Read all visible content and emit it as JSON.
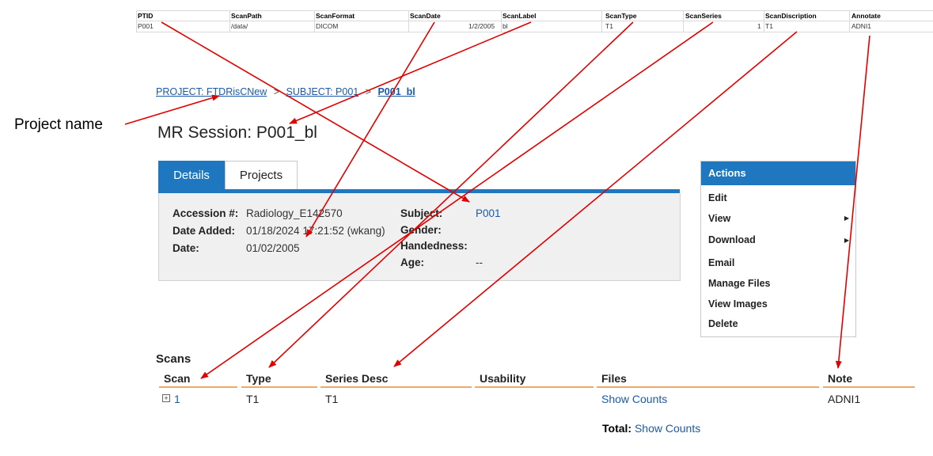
{
  "sheet": {
    "headers": [
      "PTID",
      "ScanPath",
      "ScanFormat",
      "ScanDate",
      "ScanLabel",
      "ScanType",
      "ScanSeries",
      "ScanDiscription",
      "Annotate"
    ],
    "values": [
      "P001",
      "/data/",
      "DICOM",
      "1/2/2005",
      "bl",
      "T1",
      "1",
      "T1",
      "ADNI1"
    ]
  },
  "annotation": {
    "project_name": "Project name"
  },
  "breadcrumb": {
    "project": "PROJECT: FTDRisCNew",
    "sep1": ">",
    "subject": "SUBJECT: P001",
    "sep2": ">",
    "session": "P001_bl"
  },
  "title": "MR Session: P001_bl",
  "tabs": {
    "details": "Details",
    "projects": "Projects"
  },
  "details": {
    "accession_label": "Accession #:",
    "accession_value": "Radiology_E142570",
    "date_added_label": "Date Added:",
    "date_added_value": "01/18/2024 17:21:52 (wkang)",
    "date_label": "Date:",
    "date_value": "01/02/2005",
    "subject_label": "Subject:",
    "subject_value": "P001",
    "gender_label": "Gender:",
    "handedness_label": "Handedness:",
    "age_label": "Age:",
    "age_value": "--"
  },
  "actions": {
    "title": "Actions",
    "items": [
      "Edit",
      "View",
      "Download",
      "Email",
      "Manage Files",
      "View Images",
      "Delete"
    ]
  },
  "scans": {
    "heading": "Scans",
    "columns": [
      "Scan",
      "Type",
      "Series Desc",
      "Usability",
      "Files",
      "Note"
    ],
    "row": {
      "scan": "1",
      "type": "T1",
      "series_desc": "T1",
      "usability": "",
      "files": "Show Counts",
      "note": "ADNI1"
    },
    "total_label": "Total:",
    "total_link": "Show Counts"
  },
  "colors": {
    "accent": "#1f77c0",
    "link": "#1a5aa8",
    "arrow": "#e00000",
    "underline": "#f0a860"
  },
  "icons": [
    "expand-plus-icon",
    "submenu-arrow-icon"
  ]
}
